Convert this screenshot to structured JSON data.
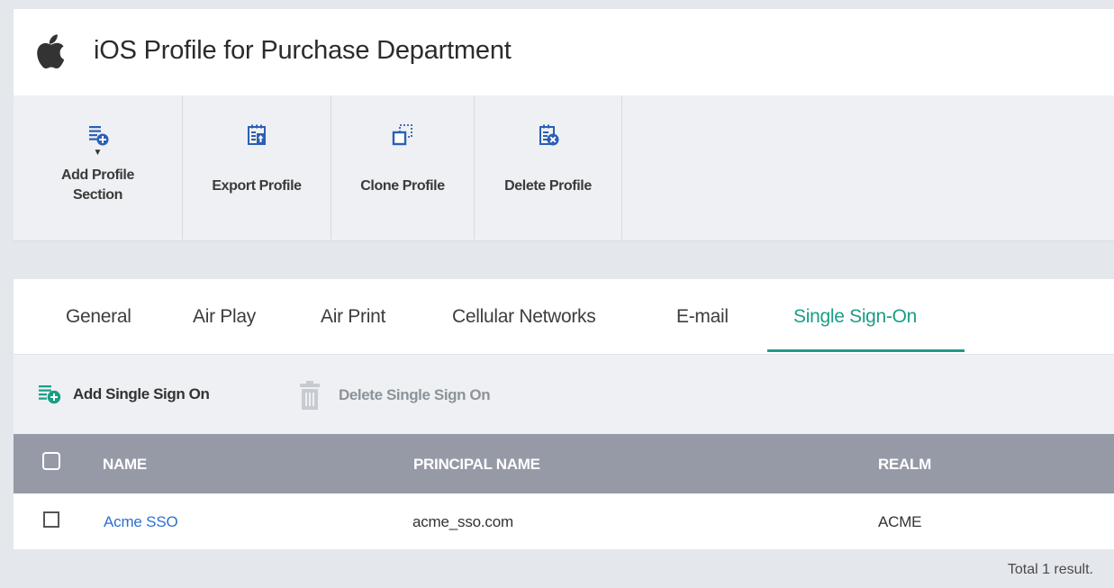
{
  "header": {
    "title": "iOS Profile for Purchase Department",
    "icon": "apple-icon"
  },
  "toolbar": {
    "add_section_line1": "Add Profile",
    "add_section_line2": "Section",
    "export_label": "Export Profile",
    "clone_label": "Clone Profile",
    "delete_label": "Delete Profile"
  },
  "tabs": [
    {
      "label": "General"
    },
    {
      "label": "Air Play"
    },
    {
      "label": "Air Print"
    },
    {
      "label": "Cellular Networks"
    },
    {
      "label": "E-mail"
    },
    {
      "label": "Single Sign-On",
      "active": true
    }
  ],
  "actions": {
    "add_label": "Add Single Sign On",
    "delete_label": "Delete Single Sign On"
  },
  "table": {
    "columns": [
      "NAME",
      "PRINCIPAL NAME",
      "REALM"
    ],
    "rows": [
      {
        "name": "Acme SSO",
        "principal_name": "acme_sso.com",
        "realm": "ACME"
      }
    ]
  },
  "footer": {
    "total": "Total 1 result."
  },
  "colors": {
    "accent": "#1a9e86",
    "link": "#2d6fd3",
    "table_header": "#959aa6"
  }
}
